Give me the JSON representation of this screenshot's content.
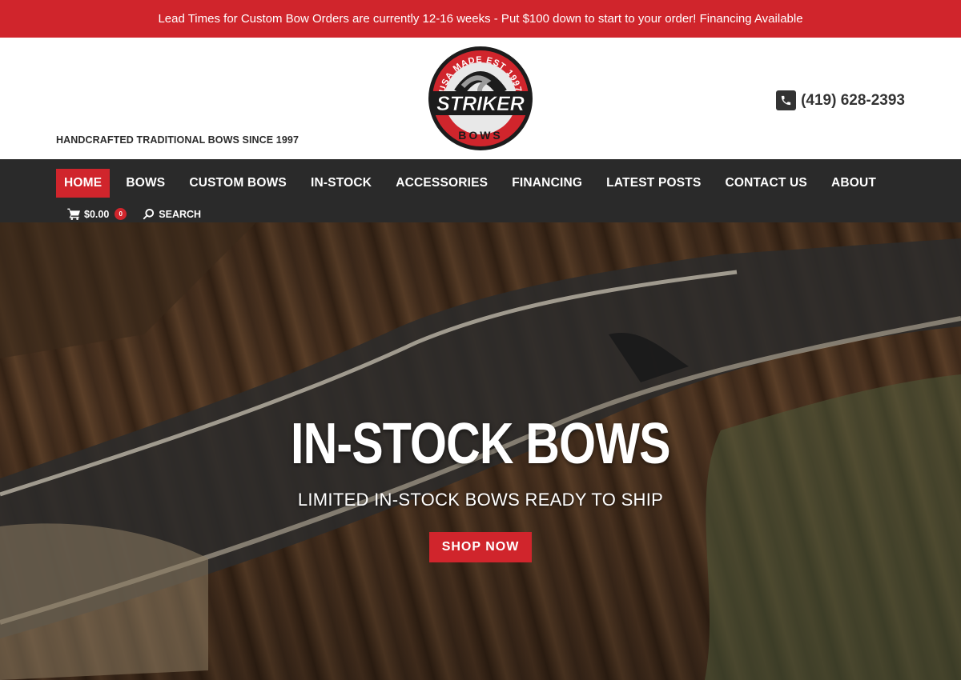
{
  "announcement": "Lead Times for Custom Bow Orders are currently 12-16 weeks - Put $100 down to start to your order! Financing Available",
  "header": {
    "tagline": "HANDCRAFTED TRADITIONAL BOWS SINCE 1997",
    "logo": {
      "ring_text": "USA MADE EST 1997",
      "brand": "STRIKER",
      "sub": "BOWS"
    },
    "phone": "(419) 628-2393",
    "phone_icon": "phone-icon"
  },
  "nav": {
    "items": [
      {
        "label": "HOME",
        "active": true
      },
      {
        "label": "BOWS"
      },
      {
        "label": "CUSTOM BOWS"
      },
      {
        "label": "IN-STOCK"
      },
      {
        "label": "ACCESSORIES"
      },
      {
        "label": "FINANCING"
      },
      {
        "label": "LATEST POSTS"
      },
      {
        "label": "CONTACT US"
      },
      {
        "label": "ABOUT"
      }
    ],
    "cart_total": "$0.00",
    "cart_count": "0",
    "search_label": "SEARCH"
  },
  "hero": {
    "title": "IN-STOCK BOWS",
    "subtitle": "LIMITED IN-STOCK BOWS READY TO SHIP",
    "cta": "SHOP NOW"
  },
  "colors": {
    "accent": "#d0252c",
    "nav_bg": "#2a2a2a"
  }
}
